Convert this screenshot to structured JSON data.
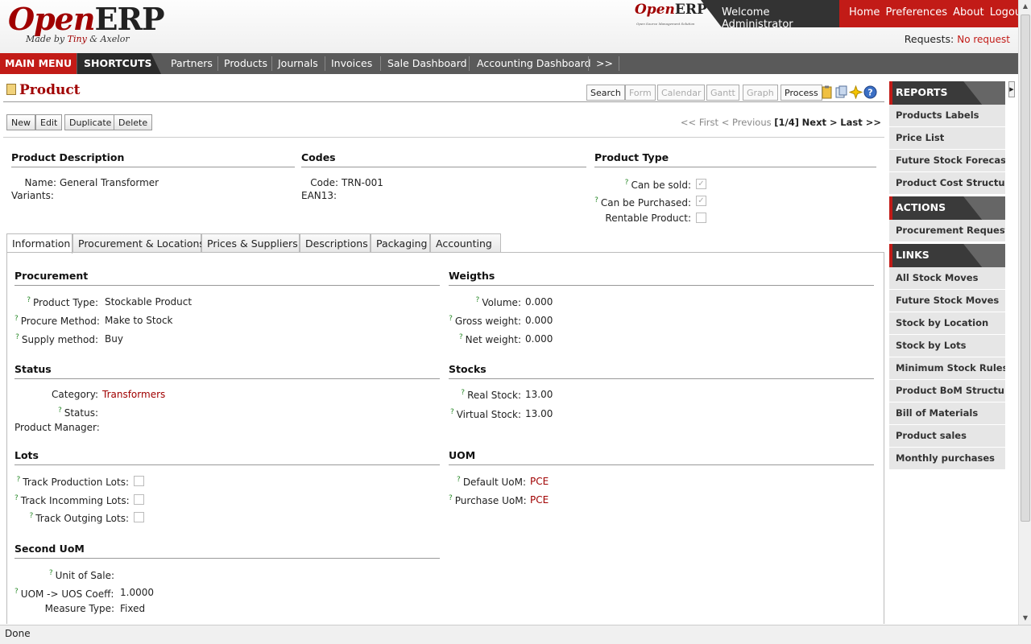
{
  "header": {
    "logo_open": "Open",
    "logo_erp": "ERP",
    "logo_sub_prefix": "Made by",
    "logo_sub_tiny": "Tiny",
    "logo_sub_rest": "& Axelor",
    "small_logo_open": "Open",
    "small_logo_erp": "ERP",
    "small_logo_tagline": "Open Source Management Solution",
    "welcome": "Welcome Administrator",
    "links": [
      "Home",
      "Preferences",
      "About",
      "Logout"
    ],
    "requests_label": "Requests:",
    "requests_value": "No request"
  },
  "menu": {
    "main_menu": "MAIN MENU",
    "shortcuts": "SHORTCUTS",
    "items": [
      "Partners",
      "Products",
      "Journals",
      "Invoices",
      "Sale Dashboard",
      "Accounting Dashboard",
      ">>"
    ]
  },
  "page": {
    "title": "Product",
    "view_buttons": [
      "Search",
      "Form",
      "Calendar",
      "Gantt",
      "Graph",
      "Process"
    ],
    "actions": [
      "New",
      "Edit",
      "Duplicate",
      "Delete"
    ],
    "pager": {
      "first": "<< First",
      "previous": "< Previous",
      "position": "[1/4]",
      "next": "Next >",
      "last": "Last >>"
    }
  },
  "form": {
    "product_description": {
      "heading": "Product Description",
      "name_label": "Name:",
      "name_value": "General Transformer",
      "variants_label": "Variants:"
    },
    "codes": {
      "heading": "Codes",
      "code_label": "Code:",
      "code_value": "TRN-001",
      "ean_label": "EAN13:"
    },
    "product_type": {
      "heading": "Product Type",
      "sold_label": "Can be sold:",
      "sold_checked": true,
      "purchased_label": "Can be Purchased:",
      "purchased_checked": true,
      "rentable_label": "Rentable Product:",
      "rentable_checked": false
    }
  },
  "tabs": [
    "Information",
    "Procurement & Locations",
    "Prices & Suppliers",
    "Descriptions",
    "Packaging",
    "Accounting"
  ],
  "info": {
    "procurement": {
      "heading": "Procurement",
      "type_label": "Product Type:",
      "type_value": "Stockable Product",
      "method_label": "Procure Method:",
      "method_value": "Make to Stock",
      "supply_label": "Supply method:",
      "supply_value": "Buy"
    },
    "weights": {
      "heading": "Weigths",
      "volume_label": "Volume:",
      "volume_value": "0.000",
      "gross_label": "Gross weight:",
      "gross_value": "0.000",
      "net_label": "Net weight:",
      "net_value": "0.000"
    },
    "status": {
      "heading": "Status",
      "category_label": "Category:",
      "category_value": "Transformers",
      "status_label": "Status:",
      "manager_label": "Product Manager:"
    },
    "stocks": {
      "heading": "Stocks",
      "real_label": "Real Stock:",
      "real_value": "13.00",
      "virtual_label": "Virtual Stock:",
      "virtual_value": "13.00"
    },
    "lots": {
      "heading": "Lots",
      "production_label": "Track Production Lots:",
      "incoming_label": "Track Incomming Lots:",
      "outgoing_label": "Track Outging Lots:"
    },
    "uom": {
      "heading": "UOM",
      "default_label": "Default UoM:",
      "default_value": "PCE",
      "purchase_label": "Purchase UoM:",
      "purchase_value": "PCE"
    },
    "second_uom": {
      "heading": "Second UoM",
      "sale_label": "Unit of Sale:",
      "coeff_label": "UOM -> UOS Coeff:",
      "coeff_value": "1.0000",
      "measure_label": "Measure Type:",
      "measure_value": "Fixed"
    }
  },
  "sidebar": {
    "reports_heading": "REPORTS",
    "reports": [
      "Products Labels",
      "Price List",
      "Future Stock Forecast",
      "Product Cost Structure"
    ],
    "actions_heading": "ACTIONS",
    "actions": [
      "Procurement Request"
    ],
    "links_heading": "LINKS",
    "links": [
      "All Stock Moves",
      "Future Stock Moves",
      "Stock by Location",
      "Stock by Lots",
      "Minimum Stock Rules",
      "Product BoM Structure",
      "Bill of Materials",
      "Product sales",
      "Monthly purchases"
    ]
  },
  "statusbar": {
    "text": "Done"
  },
  "colors": {
    "brand_red": "#c21b17",
    "dark": "#333333",
    "link": "#a00000"
  }
}
